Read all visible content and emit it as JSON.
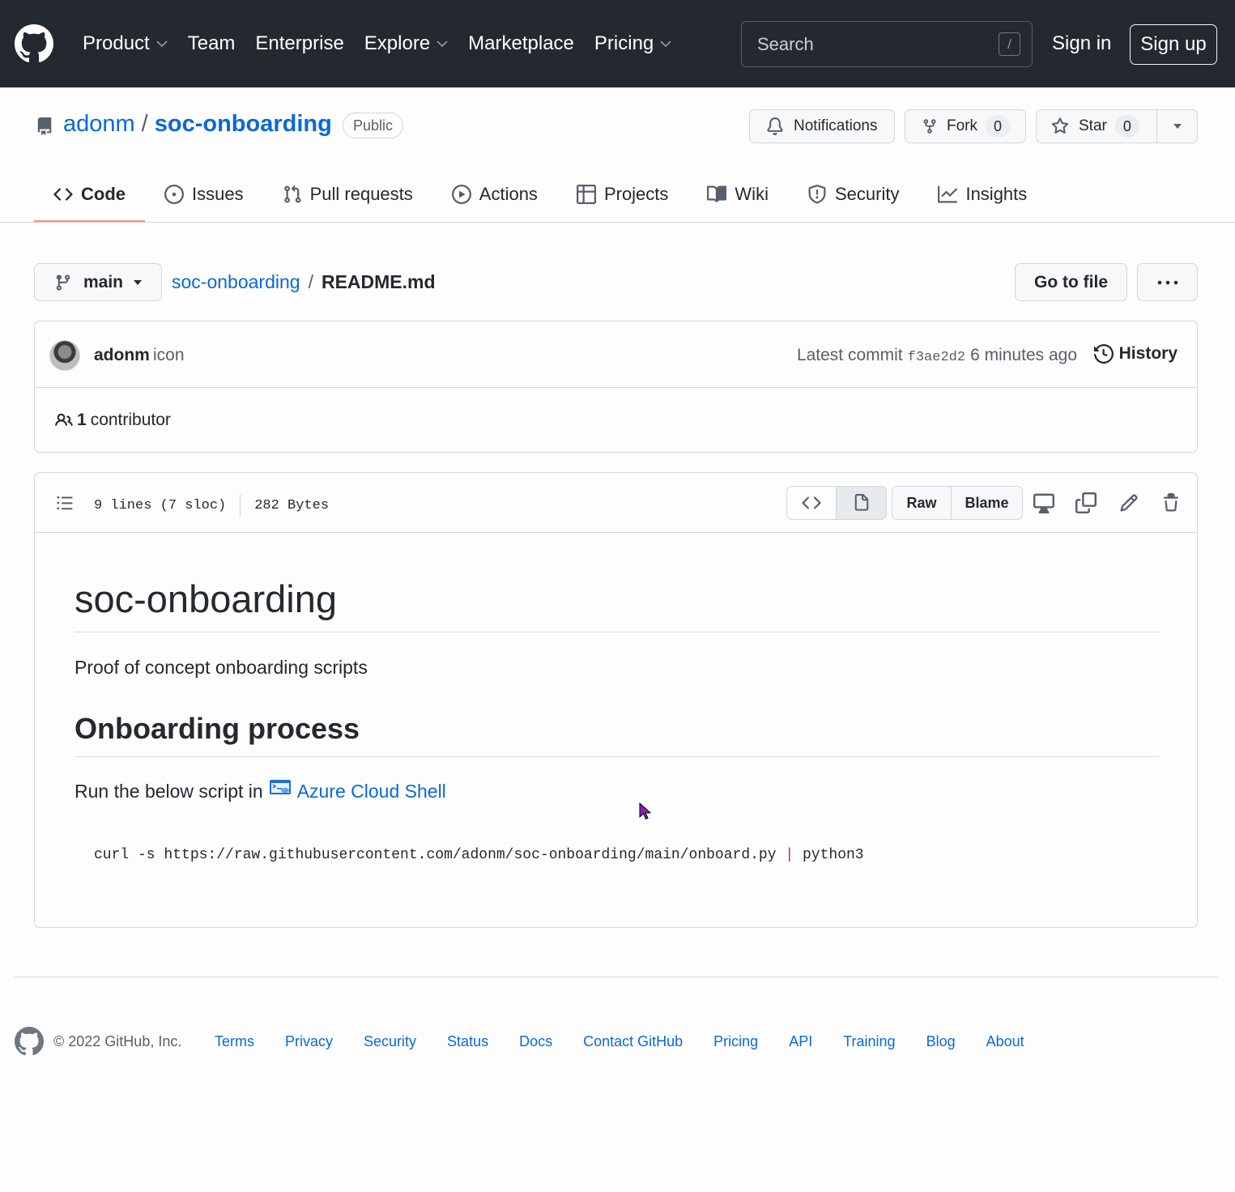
{
  "header": {
    "nav": [
      {
        "label": "Product",
        "dropdown": true
      },
      {
        "label": "Team",
        "dropdown": false
      },
      {
        "label": "Enterprise",
        "dropdown": false
      },
      {
        "label": "Explore",
        "dropdown": true
      },
      {
        "label": "Marketplace",
        "dropdown": false
      },
      {
        "label": "Pricing",
        "dropdown": true
      }
    ],
    "search_placeholder": "Search",
    "search_shortcut": "/",
    "sign_in": "Sign in",
    "sign_up": "Sign up"
  },
  "repo": {
    "owner": "adonm",
    "separator": "/",
    "name": "soc-onboarding",
    "visibility": "Public",
    "notifications_label": "Notifications",
    "fork_label": "Fork",
    "fork_count": "0",
    "star_label": "Star",
    "star_count": "0"
  },
  "tabs": [
    {
      "label": "Code",
      "icon": "code-icon",
      "active": true
    },
    {
      "label": "Issues",
      "icon": "issue-icon",
      "active": false
    },
    {
      "label": "Pull requests",
      "icon": "pull-request-icon",
      "active": false
    },
    {
      "label": "Actions",
      "icon": "play-icon",
      "active": false
    },
    {
      "label": "Projects",
      "icon": "table-icon",
      "active": false
    },
    {
      "label": "Wiki",
      "icon": "book-icon",
      "active": false
    },
    {
      "label": "Security",
      "icon": "shield-icon",
      "active": false
    },
    {
      "label": "Insights",
      "icon": "graph-icon",
      "active": false
    }
  ],
  "breadcrumb": {
    "branch": "main",
    "repo": "soc-onboarding",
    "separator": "/",
    "file": "README.md",
    "go_to_file": "Go to file"
  },
  "commit": {
    "author": "adonm",
    "author_suffix": "icon",
    "latest_commit_label": "Latest commit",
    "sha": "f3ae2d2",
    "time": "6 minutes ago",
    "history_label": "History",
    "contributors_count": "1",
    "contributors_label": "contributor"
  },
  "file": {
    "lines": "9 lines (7 sloc)",
    "size": "282 Bytes",
    "raw_label": "Raw",
    "blame_label": "Blame"
  },
  "readme": {
    "h1": "soc-onboarding",
    "p1": "Proof of concept onboarding scripts",
    "h2": "Onboarding process",
    "p2_prefix": "Run the below script in",
    "p2_link": "Azure Cloud Shell",
    "code_cmd": "curl -s https://raw.githubusercontent.com/adonm/soc-onboarding/main/onboard.py",
    "code_pipe": "|",
    "code_tail": "python3"
  },
  "footer": {
    "copyright": "© 2022 GitHub, Inc.",
    "links": [
      "Terms",
      "Privacy",
      "Security",
      "Status",
      "Docs",
      "Contact GitHub",
      "Pricing",
      "API",
      "Training",
      "Blog",
      "About"
    ]
  },
  "colors": {
    "header_bg": "#24292f",
    "link": "#0969da",
    "active_tab_underline": "#fd8c73",
    "pipe": "#cf222e"
  }
}
